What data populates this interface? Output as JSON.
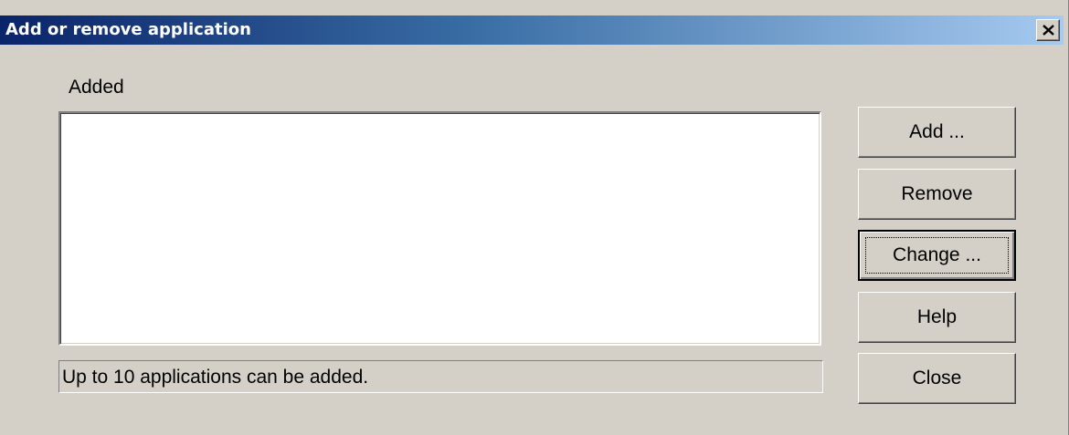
{
  "window": {
    "title": "Add or remove application",
    "close_icon": "close-x-icon"
  },
  "main": {
    "added_label": "Added",
    "added_items": [],
    "status_text": "Up to 10 applications can be added."
  },
  "buttons": {
    "add": "Add ...",
    "remove": "Remove",
    "change": "Change ...",
    "help": "Help",
    "close": "Close",
    "default_button": "change"
  },
  "colors": {
    "dialog_bg": "#d4d0c8",
    "title_gradient_start": "#0a246a",
    "title_gradient_end": "#a6caf0",
    "title_text": "#ffffff",
    "list_bg": "#ffffff"
  }
}
